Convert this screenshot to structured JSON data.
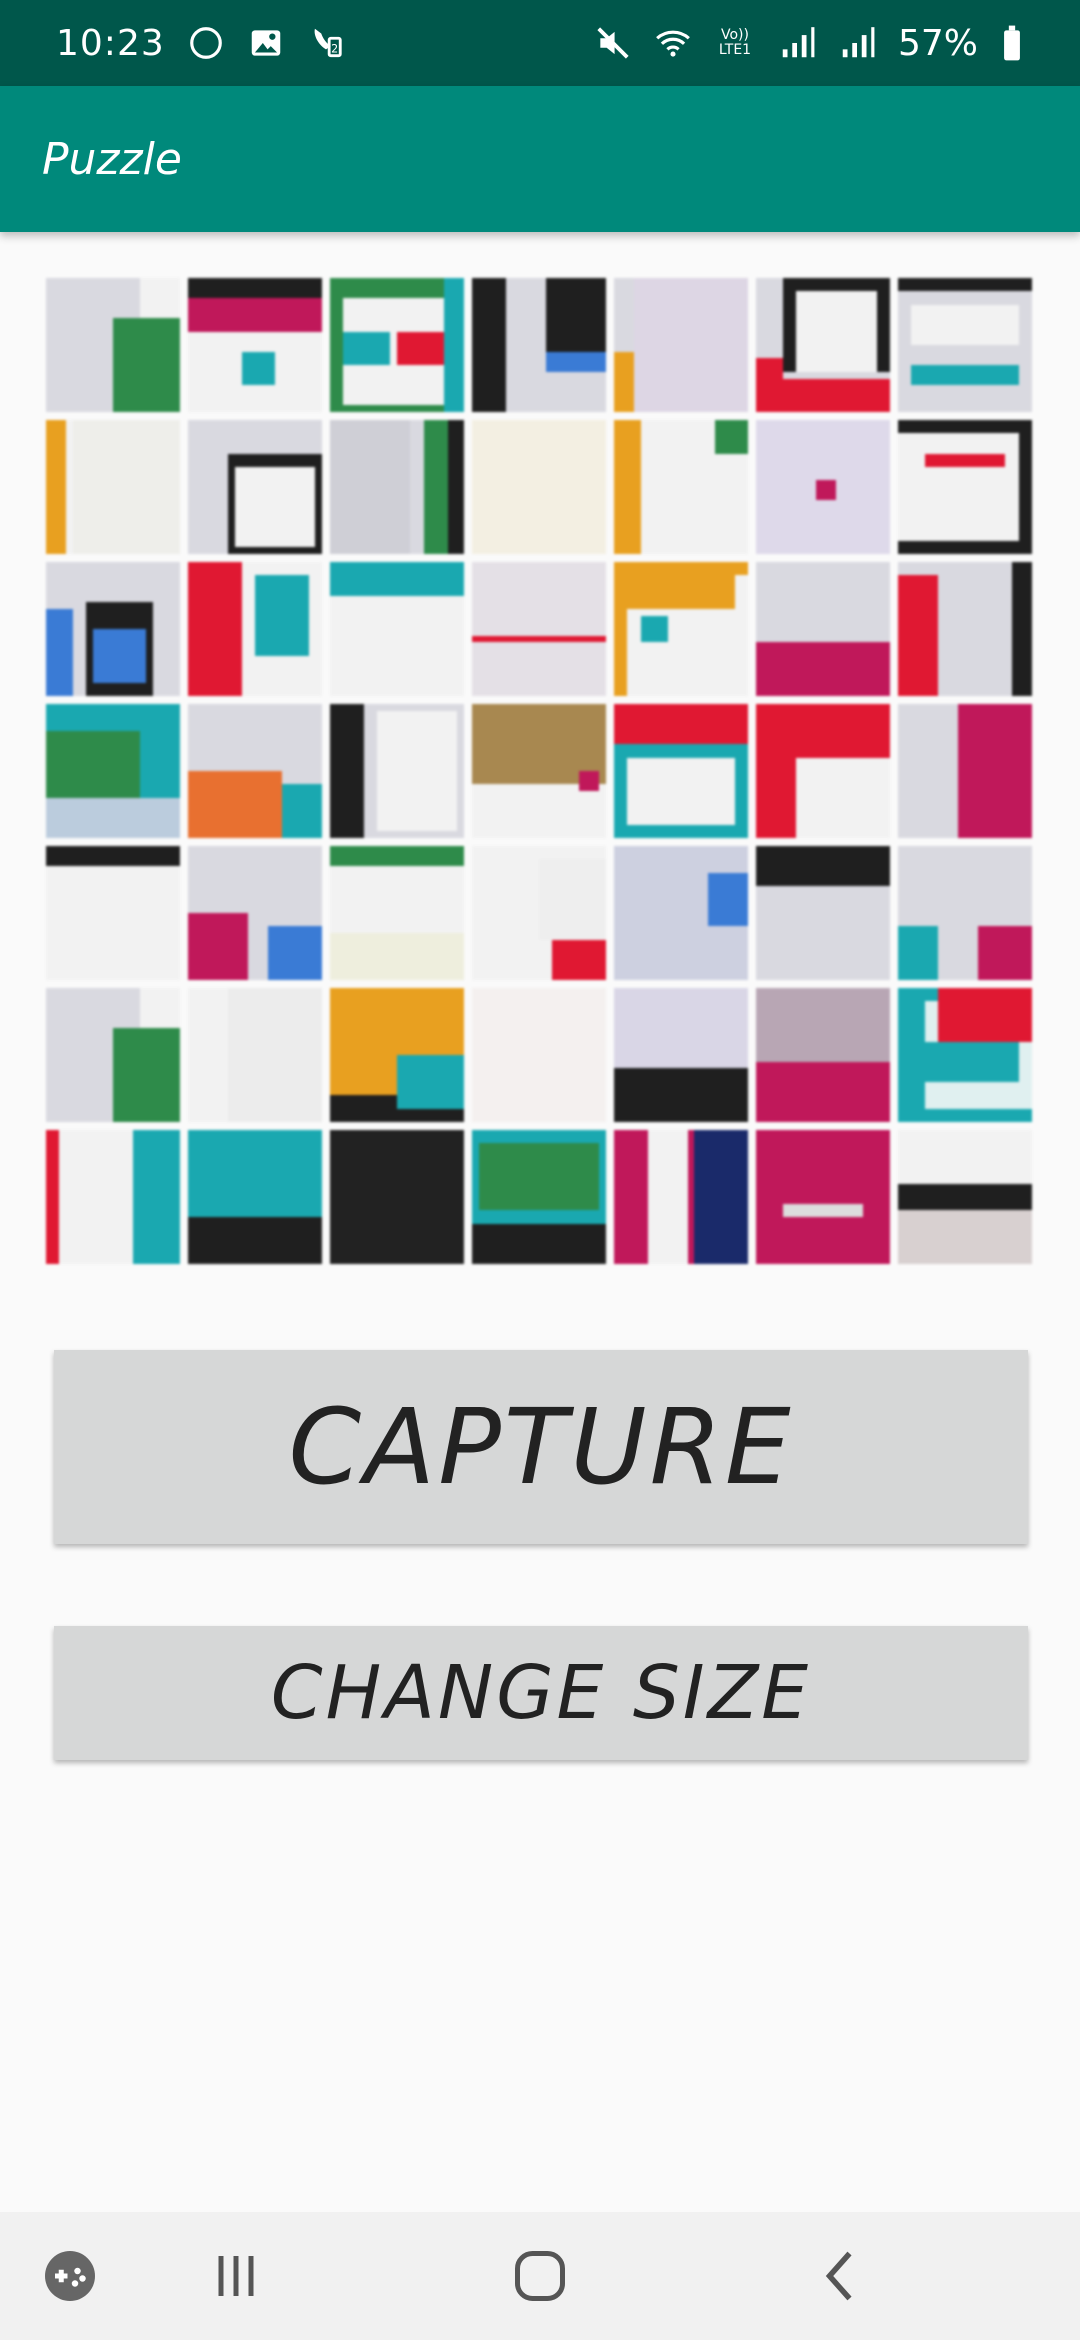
{
  "status_bar": {
    "time": "10:23",
    "network_label": "Vo)) LTE1",
    "battery": "57%"
  },
  "app_bar": {
    "title": "Puzzle"
  },
  "buttons": {
    "capture": "CAPTURE",
    "change_size": "CHANGE SIZE"
  },
  "puzzle": {
    "rows": 7,
    "columns": 7
  },
  "colors": {
    "status_bar": "#00574b",
    "app_bar": "#00897b",
    "button_bg": "#d6d7d7",
    "nav_bar": "#f1f1f1",
    "background": "#fafafa"
  },
  "icons": {
    "status_left": [
      "moon-icon",
      "image-icon",
      "wifi-call-icon"
    ],
    "status_right": [
      "mute-icon",
      "wifi-icon",
      "signal-icon",
      "signal-icon",
      "battery-icon"
    ],
    "nav": [
      "game-launcher-icon",
      "recent-apps-icon",
      "home-icon",
      "back-icon"
    ]
  }
}
